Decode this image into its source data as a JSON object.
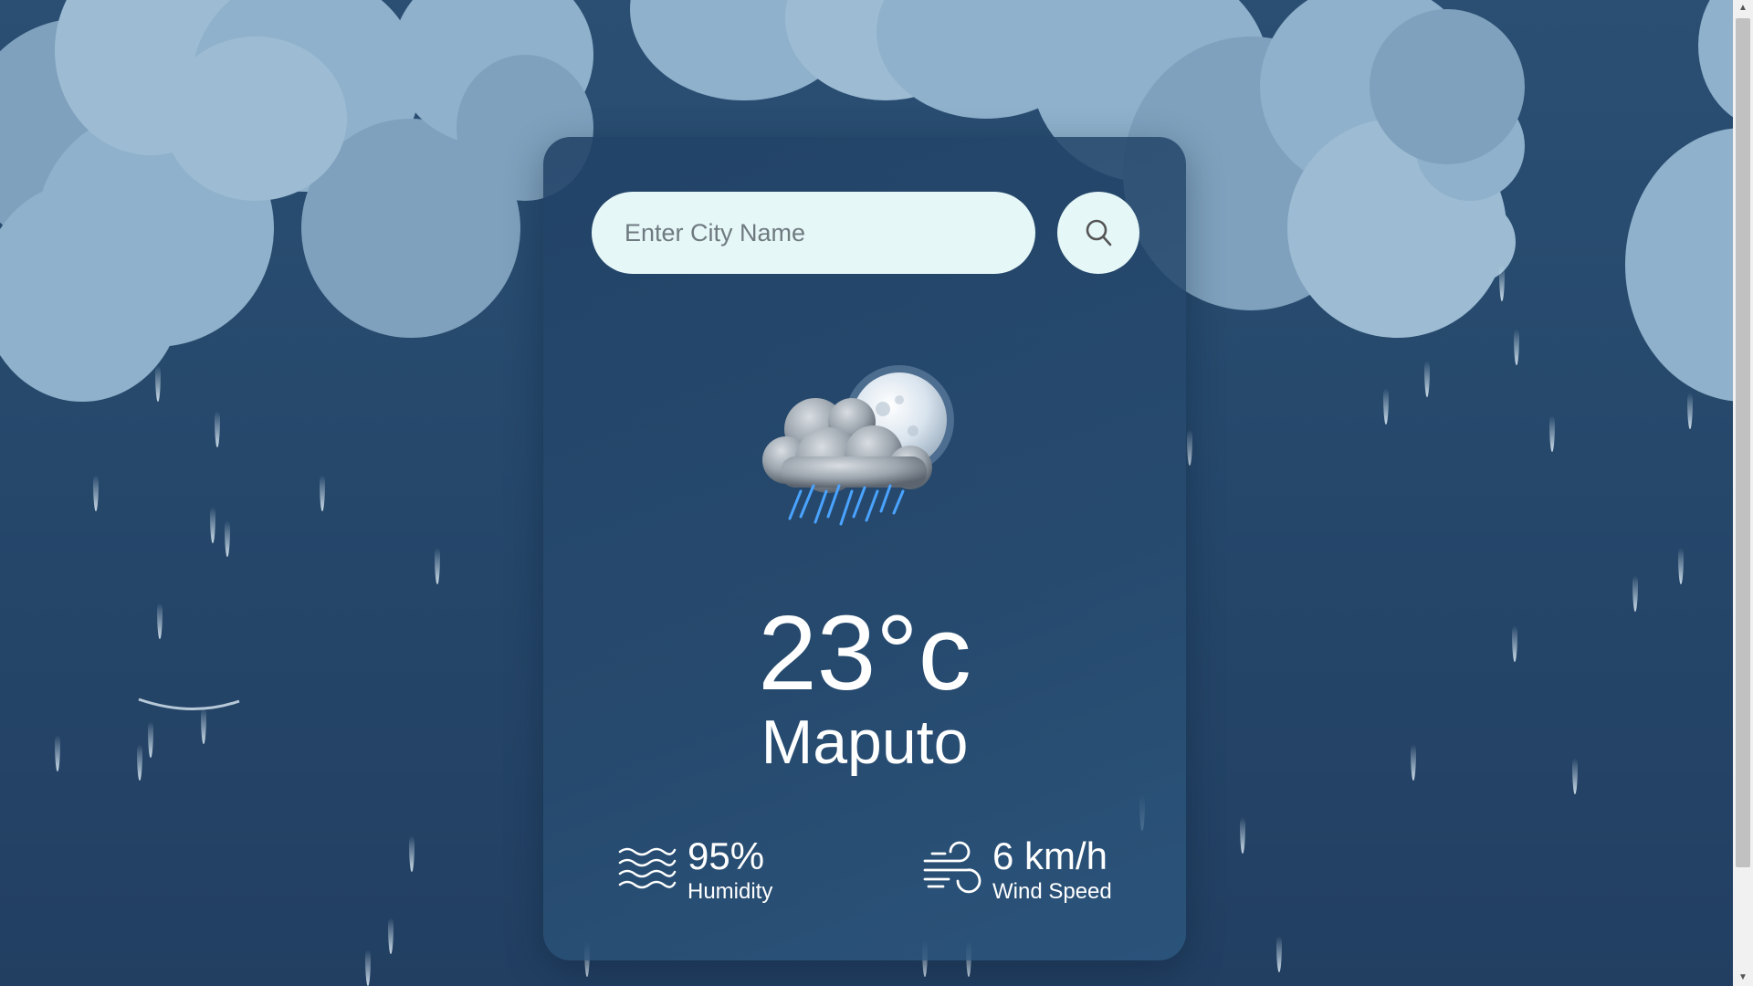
{
  "search": {
    "placeholder": "Enter City Name",
    "button_icon": "search-icon"
  },
  "weather": {
    "icon": "night-rain-cloud-moon-icon",
    "temperature": "23°c",
    "city": "Maputo"
  },
  "stats": {
    "humidity": {
      "value": "95%",
      "label": "Humidity",
      "icon": "humidity-waves-icon"
    },
    "wind": {
      "value": "6 km/h",
      "label": "Wind Speed",
      "icon": "wind-icon"
    }
  },
  "colors": {
    "background": "#26496c",
    "cloud": "#8fb1cb",
    "card": "#264a6e",
    "input_background": "#e6f7f7",
    "text": "#ffffff"
  }
}
